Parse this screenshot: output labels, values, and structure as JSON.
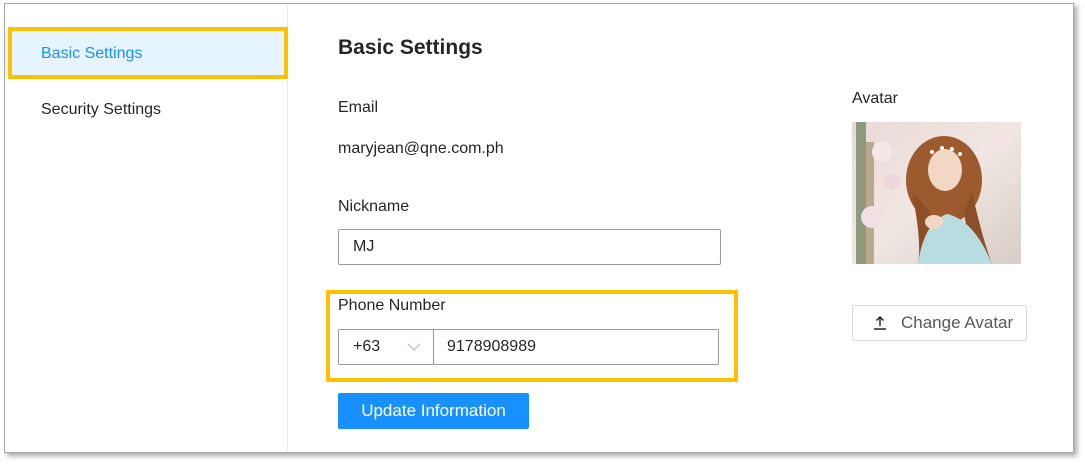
{
  "sidebar": {
    "items": [
      {
        "label": "Basic Settings",
        "active": true
      },
      {
        "label": "Security Settings",
        "active": false
      }
    ]
  },
  "main": {
    "title": "Basic Settings",
    "email": {
      "label": "Email",
      "value": "maryjean@qne.com.ph"
    },
    "nickname": {
      "label": "Nickname",
      "value": "MJ"
    },
    "phone": {
      "label": "Phone Number",
      "country_code": "+63",
      "number": "9178908989"
    },
    "update_button": "Update Information"
  },
  "avatar": {
    "label": "Avatar",
    "change_button": "Change Avatar",
    "icon": "upload-icon"
  },
  "colors": {
    "accent": "#1890ff",
    "active_menu_bg": "#e6f4ff",
    "highlight": "#ffc000"
  }
}
